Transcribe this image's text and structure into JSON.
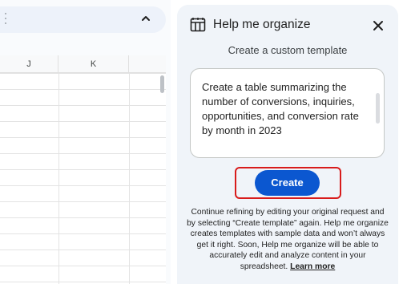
{
  "sheet": {
    "columns": [
      "J",
      "K"
    ]
  },
  "panel": {
    "title": "Help me organize",
    "subtitle": "Create a custom template",
    "prompt_text": "Create a table summarizing the number of conversions, inquiries, opportunities, and conversion rate by month in 2023",
    "create_label": "Create",
    "disclaimer_text": "Continue refining by editing your original request and by selecting “Create template” again. Help me organize creates templates with sample data and won’t always get it right. Soon, Help me organize will be able to accurately edit and analyze content in your spreadsheet.",
    "learn_more_label": "Learn more"
  },
  "icons": {
    "menu": "kebab-icon",
    "collapse": "chevron-up-icon",
    "panel": "table-icon",
    "close": "close-icon"
  },
  "colors": {
    "accent": "#0b57d0",
    "highlight": "#d81b1b",
    "panel_bg": "#f0f4f9"
  }
}
